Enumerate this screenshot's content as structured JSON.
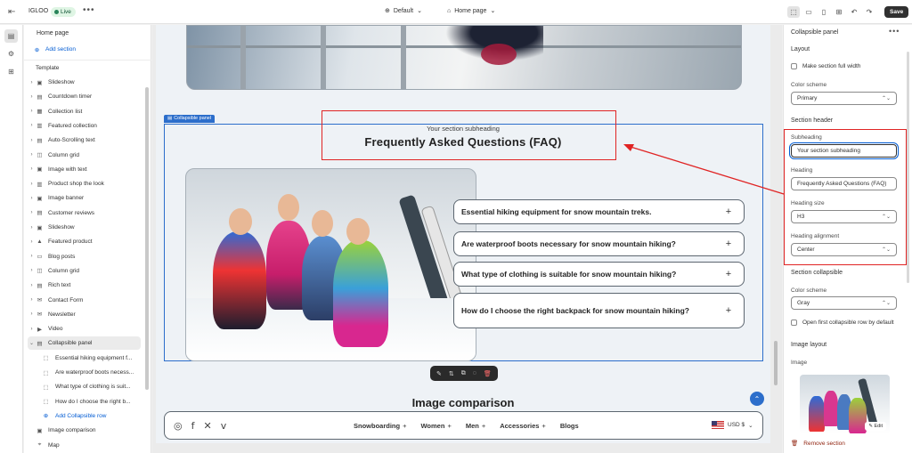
{
  "topbar": {
    "store_name": "IGLOO",
    "live_label": "Live",
    "more": "•••",
    "theme_label": "Default",
    "page_label": "Home page",
    "save_label": "Save"
  },
  "sidebar": {
    "title": "Home page",
    "add_section_top": "Add section",
    "template_label": "Template",
    "items": [
      {
        "label": "Slideshow",
        "icon": "slideshow-icon"
      },
      {
        "label": "Countdown timer",
        "icon": "timer-icon"
      },
      {
        "label": "Collection list",
        "icon": "collection-icon"
      },
      {
        "label": "Featured collection",
        "icon": "featured-collection-icon"
      },
      {
        "label": "Auto-Scrolling text",
        "icon": "text-icon"
      },
      {
        "label": "Column grid",
        "icon": "grid-icon"
      },
      {
        "label": "Image with text",
        "icon": "image-text-icon"
      },
      {
        "label": "Product shop the look",
        "icon": "product-icon"
      },
      {
        "label": "Image banner",
        "icon": "image-icon"
      },
      {
        "label": "Customer reviews",
        "icon": "reviews-icon"
      },
      {
        "label": "Slideshow",
        "icon": "slideshow-icon"
      },
      {
        "label": "Featured product",
        "icon": "featured-product-icon"
      },
      {
        "label": "Blog posts",
        "icon": "blog-icon"
      },
      {
        "label": "Column grid",
        "icon": "grid-icon"
      },
      {
        "label": "Rich text",
        "icon": "richtext-icon"
      },
      {
        "label": "Contact Form",
        "icon": "form-icon"
      },
      {
        "label": "Newsletter",
        "icon": "newsletter-icon"
      },
      {
        "label": "Video",
        "icon": "video-icon"
      },
      {
        "label": "Collapsible panel",
        "icon": "collapsible-icon"
      }
    ],
    "children": [
      {
        "label": "Essential hiking equipment f..."
      },
      {
        "label": "Are waterproof boots necess..."
      },
      {
        "label": "What type of clothing is suit..."
      },
      {
        "label": "How do I choose the right b..."
      }
    ],
    "add_collapsible_row": "Add Collapsible row",
    "after_items": [
      {
        "label": "Image comparison",
        "icon": "image-comparison-icon"
      },
      {
        "label": "Map",
        "icon": "map-icon"
      }
    ]
  },
  "canvas": {
    "section_tag": "Collapsible panel",
    "subheading": "Your section subheading",
    "heading": "Frequently Asked Questions (FAQ)",
    "faq": [
      {
        "question": "Essential hiking equipment for snow mountain treks."
      },
      {
        "question": "Are waterproof boots necessary for snow mountain hiking?"
      },
      {
        "question": "What type of clothing is suitable for snow mountain hiking?"
      },
      {
        "question": "How do I choose the right backpack for snow mountain hiking?"
      }
    ],
    "next_section_heading": "Image comparison",
    "nav": {
      "menu": [
        {
          "label": "Snowboarding",
          "has_plus": true
        },
        {
          "label": "Women",
          "has_plus": true
        },
        {
          "label": "Men",
          "has_plus": true
        },
        {
          "label": "Accessories",
          "has_plus": true
        },
        {
          "label": "Blogs",
          "has_plus": false
        }
      ],
      "currency": "USD $",
      "social": [
        "instagram-icon",
        "facebook-icon",
        "twitter-icon",
        "vimeo-icon"
      ]
    }
  },
  "panel": {
    "title": "Collapsible panel",
    "more": "•••",
    "layout_heading": "Layout",
    "full_width_label": "Make section full width",
    "color_scheme_label": "Color scheme",
    "color_scheme_value": "Primary",
    "section_header_heading": "Section header",
    "subheading_label": "Subheading",
    "subheading_value": "Your section subheading",
    "heading_label": "Heading",
    "heading_value": "Frequently Asked Questions (FAQ)",
    "heading_size_label": "Heading size",
    "heading_size_value": "H3",
    "heading_alignment_label": "Heading alignment",
    "heading_alignment_value": "Center",
    "section_collapsible_heading": "Section collapsible",
    "color_scheme2_label": "Color scheme",
    "color_scheme2_value": "Gray",
    "open_first_label": "Open first collapsible row by default",
    "image_layout_heading": "Image layout",
    "image_label": "Image",
    "edit_label": "Edit",
    "remove_label": "Remove section"
  },
  "colors": {
    "highlight_red": "#e02424",
    "selection_blue": "#2c6ecb",
    "save_button": "#303030"
  }
}
